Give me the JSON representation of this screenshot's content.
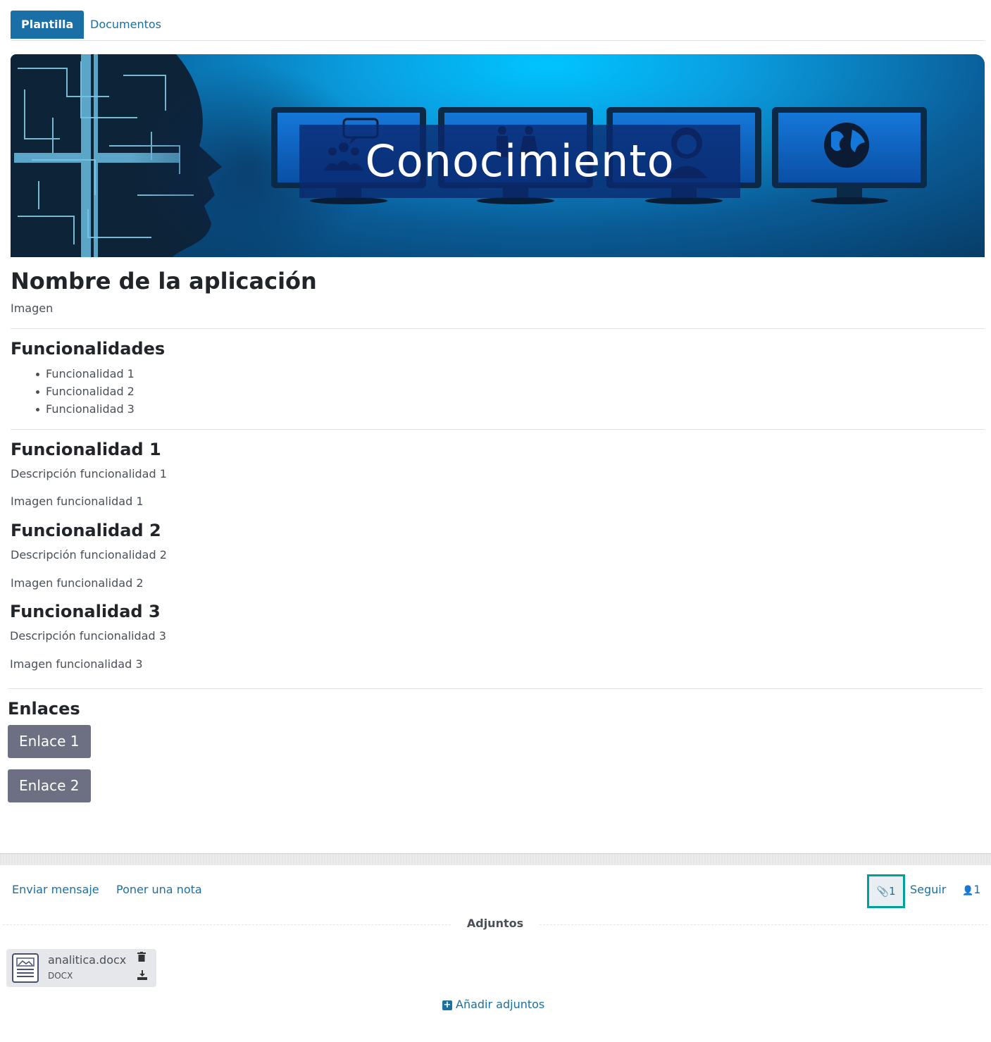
{
  "tabs": [
    {
      "label": "Plantilla",
      "active": true
    },
    {
      "label": "Documentos",
      "active": false
    }
  ],
  "banner": {
    "title": "Conocimiento"
  },
  "app": {
    "title": "Nombre de la aplicación",
    "image_label": "Imagen"
  },
  "features": {
    "heading": "Funcionalidades",
    "items": [
      "Funcionalidad 1",
      "Funcionalidad 2",
      "Funcionalidad 3"
    ]
  },
  "sections": [
    {
      "title": "Funcionalidad 1",
      "description": "Descripción funcionalidad 1",
      "image": "Imagen funcionalidad 1"
    },
    {
      "title": "Funcionalidad 2",
      "description": "Descripción funcionalidad 2",
      "image": "Imagen funcionalidad 2"
    },
    {
      "title": "Funcionalidad 3",
      "description": "Descripción funcionalidad 3",
      "image": "Imagen funcionalidad 3"
    }
  ],
  "links": {
    "heading": "Enlaces",
    "items": [
      "Enlace 1",
      "Enlace 2"
    ]
  },
  "footer": {
    "send_message": "Enviar mensaje",
    "add_note": "Poner una nota",
    "attachments_count": "1",
    "follow": "Seguir",
    "followers_count": "1"
  },
  "attachments": {
    "heading": "Adjuntos",
    "files": [
      {
        "name": "analitica.docx",
        "type": "DOCX"
      }
    ],
    "add_label": "Añadir adjuntos"
  },
  "colors": {
    "accent": "#1a6fa7",
    "link": "#1b6fa1",
    "highlight": "#00a09a",
    "button": "#6d7083"
  }
}
